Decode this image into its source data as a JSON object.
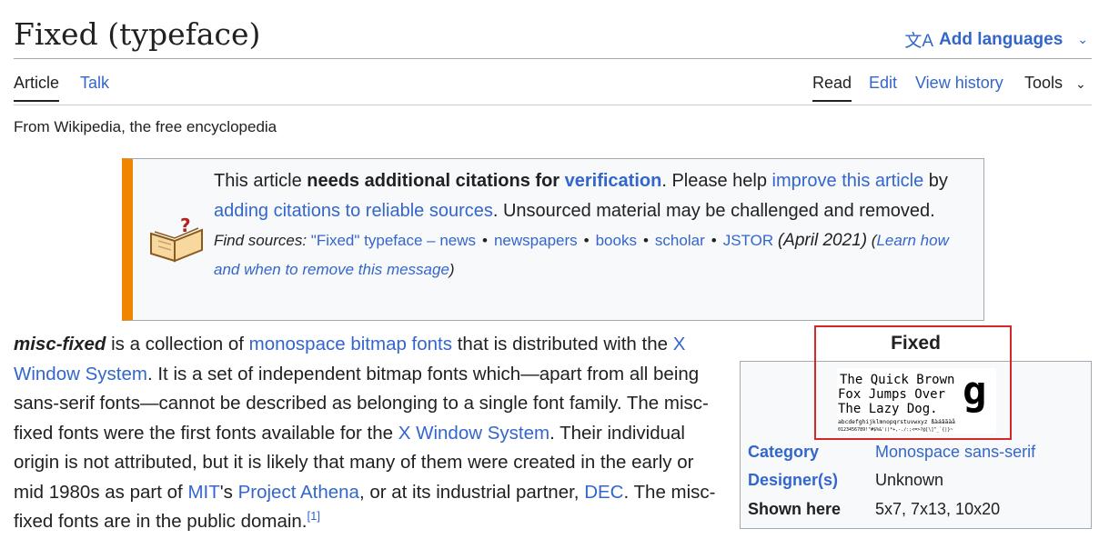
{
  "header": {
    "title": "Fixed (typeface)",
    "languages_label": "Add languages"
  },
  "tabs": {
    "article": "Article",
    "talk": "Talk",
    "read": "Read",
    "edit": "Edit",
    "view_history": "View history",
    "tools": "Tools"
  },
  "tagline": "From Wikipedia, the free encyclopedia",
  "notice": {
    "t1": "This article ",
    "t2": "needs additional citations for ",
    "t3": "verification",
    "t4": ". Please help ",
    "t5": "improve this article",
    "t6": " by ",
    "t7": "adding citations to reliable sources",
    "t8": ". Unsourced material may be challenged and removed.",
    "find_sources": "Find sources:",
    "q": "\"Fixed\" typeface",
    "dash": " – ",
    "news": "news",
    "newspapers": "newspapers",
    "books": "books",
    "scholar": "scholar",
    "jstor": "JSTOR",
    "dot": "•",
    "date": "(April 2021)",
    "paren_open": " (",
    "learn": "Learn how and when to remove this message",
    "paren_close": ")"
  },
  "body": {
    "s1": "misc-fixed",
    "s2": " is a collection of ",
    "s3": "monospace bitmap fonts",
    "s4": " that is distributed with the ",
    "s5": "X Window System",
    "s6": ". It is a set of independent bitmap fonts which—apart from all being sans-serif fonts—cannot be described as belonging to a single font family. The misc-fixed fonts were the first fonts available for the ",
    "s7": "X Window System",
    "s8": ". Their individual origin is not attributed, but it is likely that many of them were created in the early or mid 1980s as part of ",
    "s9": "MIT",
    "s10": "'s ",
    "s11": "Project Athena",
    "s12": ", or at its industrial partner, ",
    "s13": "DEC",
    "s14": ". The misc-fixed fonts are in the public domain.",
    "s15": "[1]"
  },
  "infobox": {
    "title": "Fixed",
    "sample": {
      "line1": "The Quick Brown",
      "line2": "Fox Jumps Over",
      "line3": "The Lazy Dog.",
      "glyph": "g",
      "alphabet": "abcdefghijklmnopqrstuvwxyz ßàáâãäå",
      "digits": "0123456789!\"#$%&'()*+,-./:;<=>?@[\\]^_`{|}~"
    },
    "rows": [
      {
        "label": "Category",
        "value": "Monospace sans-serif"
      },
      {
        "label": "Designer(s)",
        "value": "Unknown"
      },
      {
        "label": "Shown here",
        "value": "5x7, 7x13, 10x20"
      }
    ]
  },
  "colors": {
    "link": "#3366cc",
    "notice_accent": "#f28500",
    "highlight": "#d62728"
  }
}
